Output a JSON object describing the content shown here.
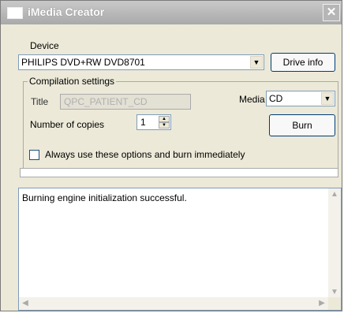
{
  "window": {
    "title": "iMedia Creator"
  },
  "device": {
    "label": "Device",
    "selected": "PHILIPS  DVD+RW DVD8701",
    "drive_info_label": "Drive info"
  },
  "compilation": {
    "legend": "Compilation settings",
    "title_label": "Title",
    "title_value": "QPC_PATIENT_CD",
    "media_label": "Media",
    "media_value": "CD",
    "copies_label": "Number of copies",
    "copies_value": "1",
    "burn_label": "Burn",
    "always_label": "Always use these options and burn immediately",
    "always_checked": false
  },
  "progress": {
    "value": 0
  },
  "log": {
    "lines": [
      "Burning engine initialization successful."
    ]
  },
  "icons": {
    "close": "close-icon",
    "dropdown": "chevron-down-icon",
    "spin_up": "arrow-up-icon",
    "spin_down": "arrow-down-icon",
    "scroll_up": "arrow-up-icon",
    "scroll_down": "arrow-down-icon",
    "scroll_left": "arrow-left-icon",
    "scroll_right": "arrow-right-icon"
  }
}
